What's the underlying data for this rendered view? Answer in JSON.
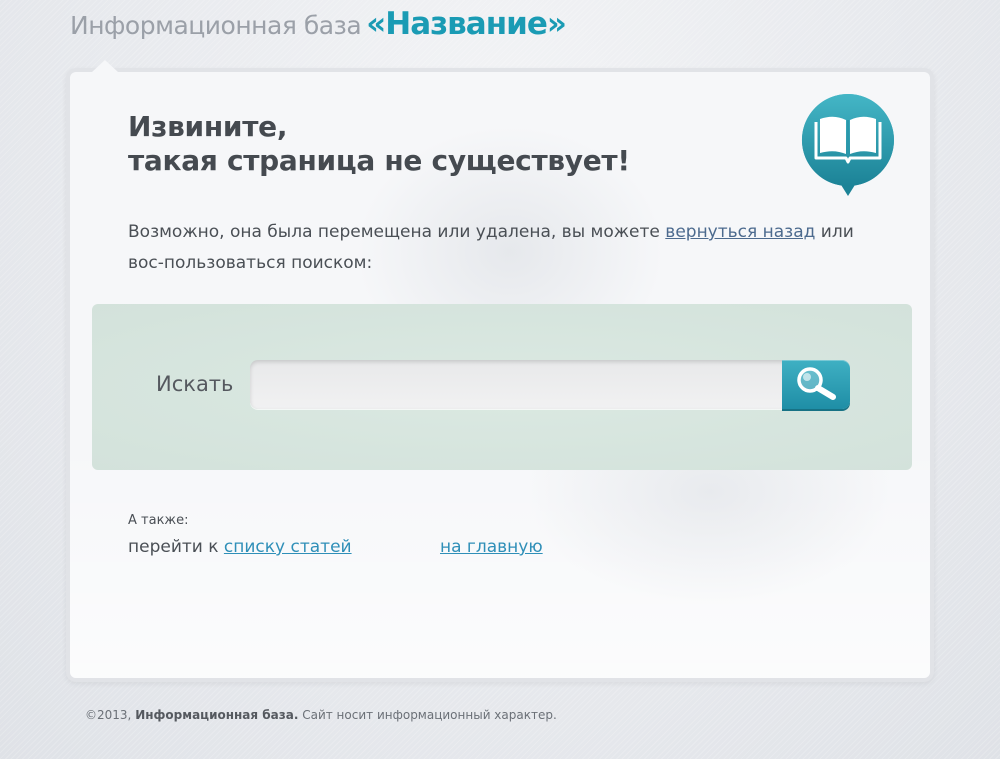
{
  "header": {
    "title_prefix": "Информационная база",
    "title_name": "«Название»"
  },
  "error": {
    "heading_line1": "Извините,",
    "heading_line2": "такая страница не существует!",
    "message_before": "Возможно, она была перемещена или удалена, вы можете ",
    "back_link": "вернуться назад",
    "message_after": " или вос-пользоваться поиском:"
  },
  "search": {
    "label": "Искать",
    "value": "",
    "placeholder": ""
  },
  "also": {
    "label": "А также:",
    "goto_prefix": "перейти к ",
    "articles_link": "списку статей",
    "home_link": "на главную"
  },
  "footer": {
    "copyright": "©2013,",
    "site_name": "Информационная база.",
    "note": "Сайт носит информационный характер."
  },
  "icons": {
    "badge": "open-book-icon",
    "search_button": "magnifier-icon"
  },
  "colors": {
    "accent": "#1a9bb4",
    "search_panel": "#d7e6df",
    "link": "#2f8fb8"
  }
}
